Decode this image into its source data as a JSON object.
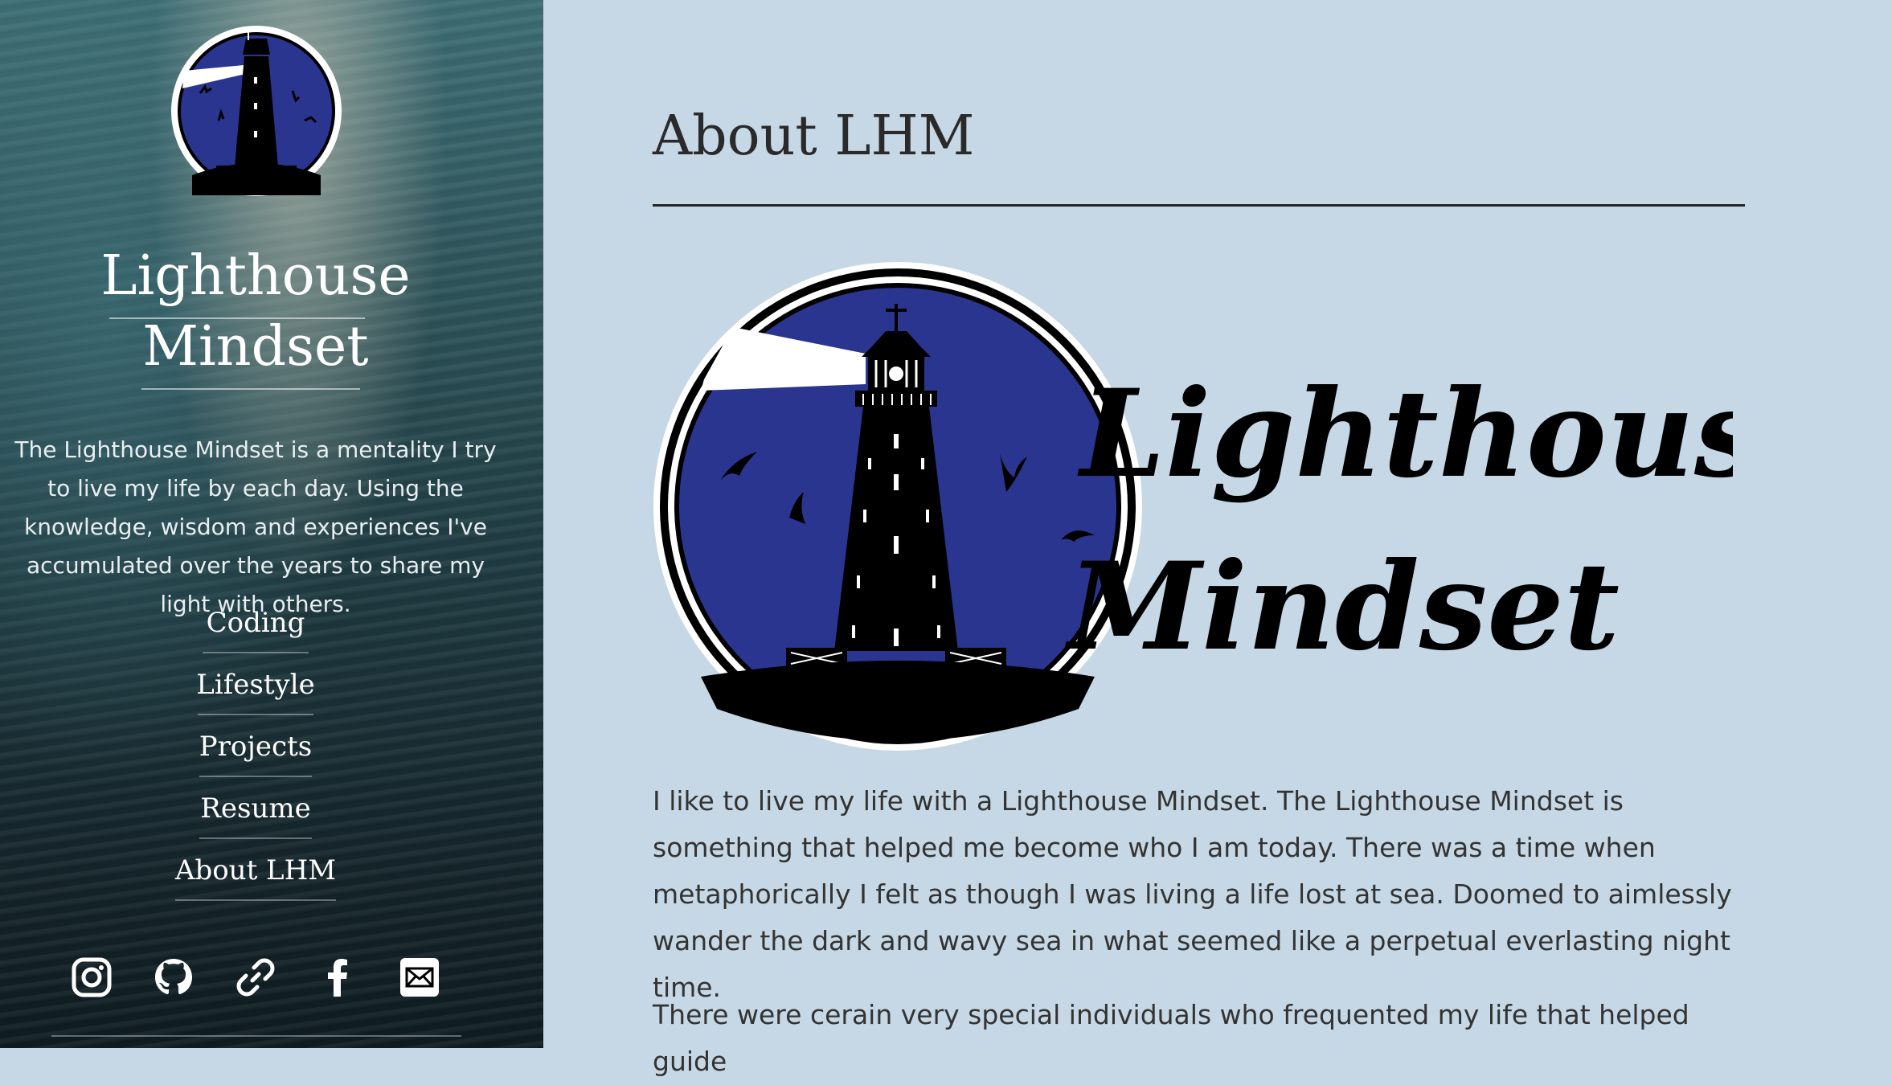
{
  "sidebar": {
    "title_line1": "Lighthouse",
    "title_line2": "Mindset",
    "tagline": "The Lighthouse Mindset is a mentality I try to live my life by each day. Using the knowledge, wisdom and experiences I've accumulated over the years to share my light with others.",
    "nav": [
      {
        "label": "Coding"
      },
      {
        "label": "Lifestyle"
      },
      {
        "label": "Projects"
      },
      {
        "label": "Resume"
      },
      {
        "label": "About LHM"
      }
    ],
    "social": [
      "instagram-icon",
      "github-icon",
      "link-icon",
      "facebook-icon",
      "email-icon"
    ]
  },
  "main": {
    "title": "About LHM",
    "logo_text_line1": "Lighthouse",
    "logo_text_line2": "Mindset",
    "paragraphs": [
      "I like to live my life with a Lighthouse Mindset. The Lighthouse Mindset is something that helped me become who I am today. There was a time when metaphorically I felt as though I was living a life lost at sea. Doomed to aimlessly wander the dark and wavy sea in what seemed like a perpetual everlasting night time.",
      "There were cerain very special individuals who frequented my life that helped guide"
    ]
  },
  "colors": {
    "background": "#c6d8e5",
    "logo_blue": "#2a3590",
    "text": "#333333"
  }
}
